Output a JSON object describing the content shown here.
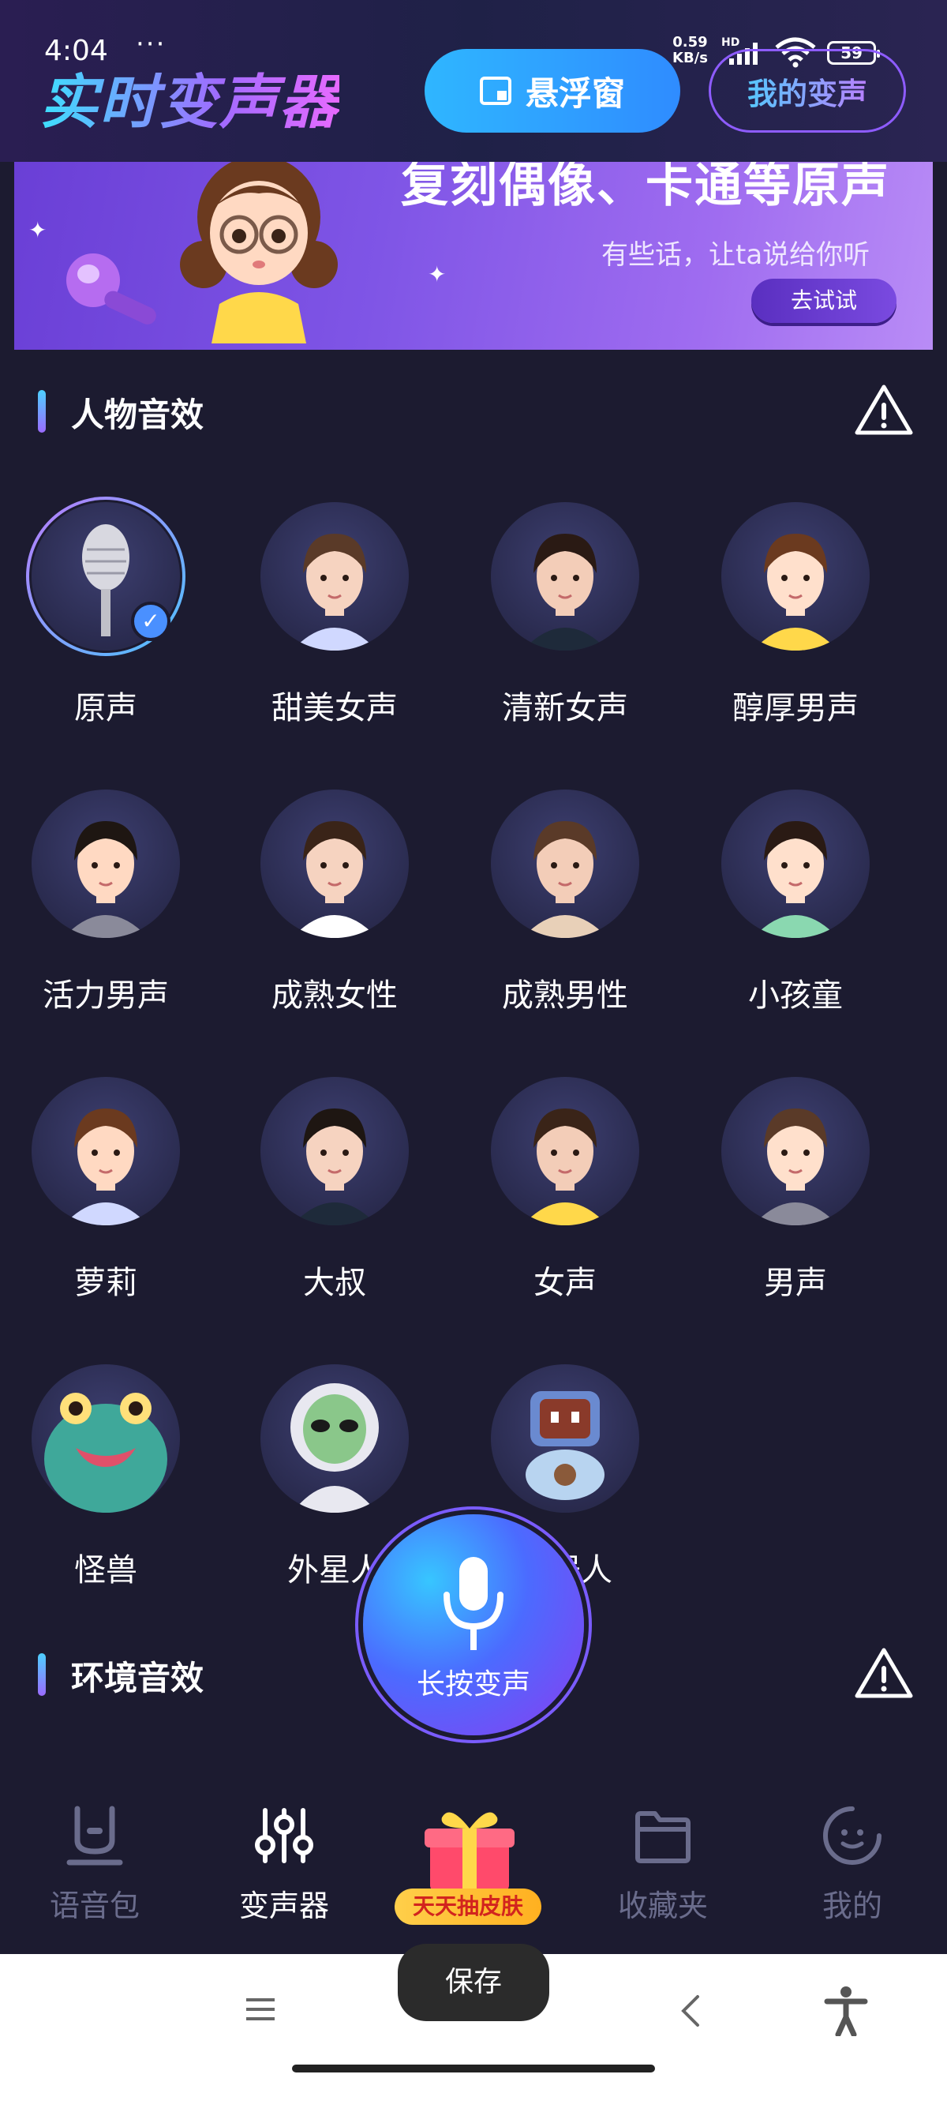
{
  "status_bar": {
    "time": "4:04",
    "dots": "···",
    "speed_value": "0.59",
    "speed_unit": "KB/s",
    "network": "HD",
    "battery": "59"
  },
  "header": {
    "app_title": "实时变声器",
    "float_window_label": "悬浮窗",
    "my_voice_label": "我的变声"
  },
  "banner": {
    "headline": "复刻偶像、卡通等原声",
    "subtitle": "有些话，让ta说给你听",
    "button_label": "去试试"
  },
  "sections": {
    "character_title": "人物音效",
    "environment_title": "环境音效"
  },
  "voices": [
    {
      "label": "原声",
      "selected": true
    },
    {
      "label": "甜美女声"
    },
    {
      "label": "清新女声"
    },
    {
      "label": "醇厚男声"
    },
    {
      "label": "活力男声"
    },
    {
      "label": "成熟女性"
    },
    {
      "label": "成熟男性"
    },
    {
      "label": "小孩童"
    },
    {
      "label": "萝莉"
    },
    {
      "label": "大叔"
    },
    {
      "label": "女声"
    },
    {
      "label": "男声"
    },
    {
      "label": "怪兽"
    },
    {
      "label": "外星人"
    },
    {
      "label": "机器人"
    }
  ],
  "mic_button": {
    "label": "长按变声"
  },
  "bottom_nav": {
    "items": [
      {
        "label": "语音包",
        "icon": "voice-pack-icon"
      },
      {
        "label": "变声器",
        "icon": "sliders-icon",
        "active": true
      },
      {
        "label": "天天抽皮肤",
        "icon": "gift-box-icon"
      },
      {
        "label": "收藏夹",
        "icon": "folder-icon"
      },
      {
        "label": "我的",
        "icon": "profile-icon"
      }
    ]
  },
  "toast": {
    "text": "保存"
  },
  "colors": {
    "background": "#1c1b30",
    "accent_blue": "#2f8cff",
    "accent_purple": "#8e5cff",
    "nav_inactive": "#6a6c8c"
  }
}
